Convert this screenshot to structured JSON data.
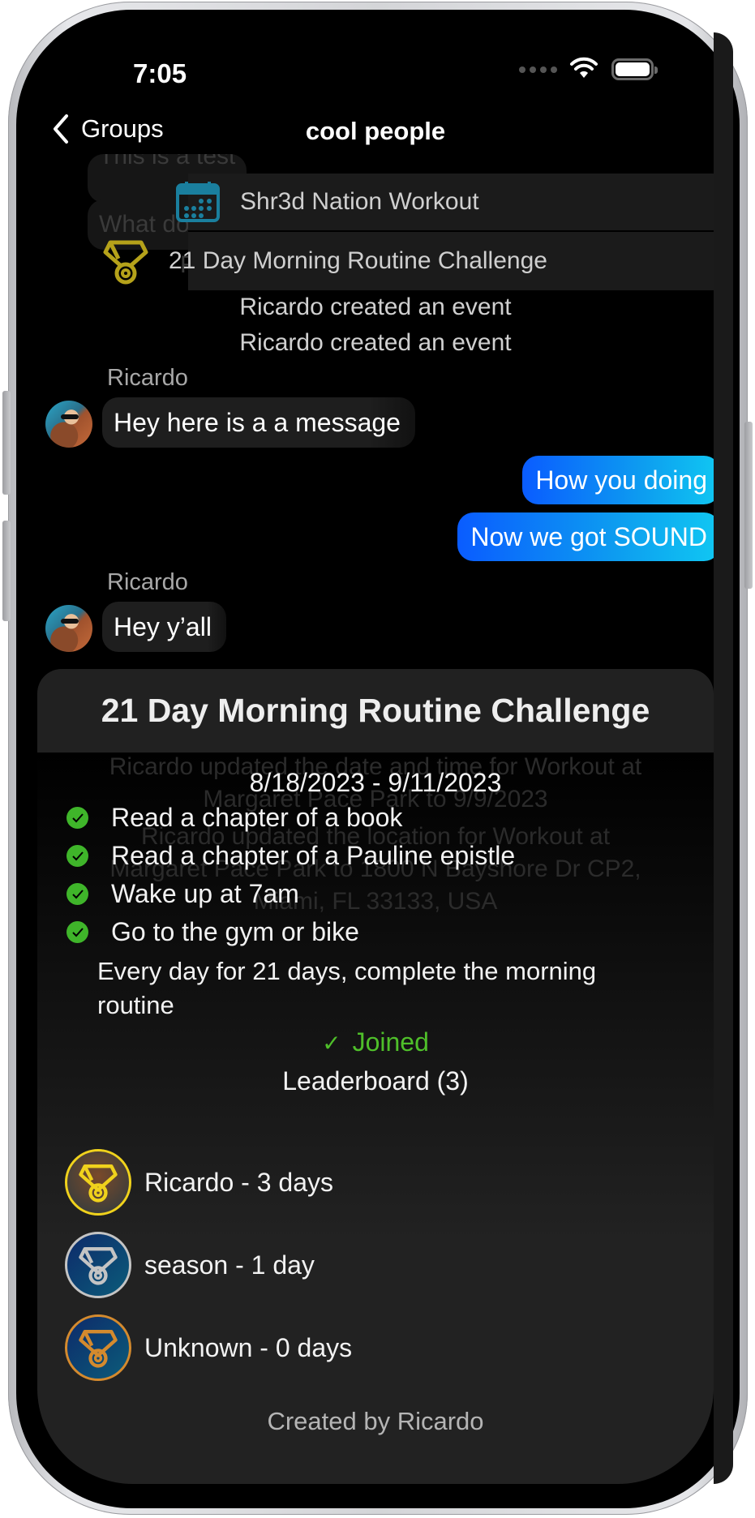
{
  "status_bar": {
    "time": "7:05"
  },
  "nav": {
    "back_label": "Groups",
    "title": "cool people"
  },
  "background_messages": {
    "bubbles": [
      "This is a test",
      "What does it do"
    ],
    "partial_system": "Ricardo cre"
  },
  "pinned": [
    {
      "icon": "calendar-icon",
      "label": "Shr3d Nation Workout"
    },
    {
      "icon": "medal-icon",
      "label": "21 Day Morning Routine Challenge"
    }
  ],
  "system_events": [
    "Ricardo created an event",
    "Ricardo created an event"
  ],
  "messages": [
    {
      "sender": "Ricardo",
      "text": "Hey here is a a message",
      "direction": "incoming"
    },
    {
      "text": "How you doing",
      "direction": "outgoing"
    },
    {
      "text": "Now we got SOUND",
      "direction": "outgoing"
    },
    {
      "sender": "Ricardo",
      "text": "Hey y’all",
      "direction": "incoming"
    }
  ],
  "ghost_background": [
    "Ricardo updated the date and time for Workout at",
    "Margaret Pace Park to 9/9/2023",
    "Margaret Pace Park to 9/9/2023",
    "Ricardo updated the location for Workout at",
    "Margaret Pace Park to 1800 N Bayshore Dr CP2,",
    "Miami, FL 33133, USA"
  ],
  "challenge": {
    "title": "21 Day Morning Routine Challenge",
    "dates": "8/18/2023 - 9/11/2023",
    "tasks": [
      {
        "label": "Read a chapter of a book",
        "done": true
      },
      {
        "label": "Read a chapter of a Pauline epistle",
        "done": true
      },
      {
        "label": "Wake up at 7am",
        "done": true
      },
      {
        "label": "Go to the gym or bike",
        "done": true
      }
    ],
    "description": "Every day for 21 days, complete the morning routine",
    "joined_label": "Joined",
    "joined_check": "✓",
    "leaderboard_title": "Leaderboard (3)",
    "leaderboard": [
      {
        "rank": "gold",
        "label": "Ricardo - 3 days",
        "color": "#f0d21c"
      },
      {
        "rank": "silver",
        "label": "season - 1 day",
        "color": "#c4c4c4"
      },
      {
        "rank": "bronze",
        "label": "Unknown - 0 days",
        "color": "#d48a2e"
      }
    ],
    "created_by": "Created by Ricardo"
  },
  "colors": {
    "accent_blue_start": "#0a5cff",
    "accent_blue_end": "#10c8f2",
    "success_green": "#4fbf2a",
    "calendar_teal": "#1a7f9e",
    "medal_gold": "#b5a21a"
  }
}
